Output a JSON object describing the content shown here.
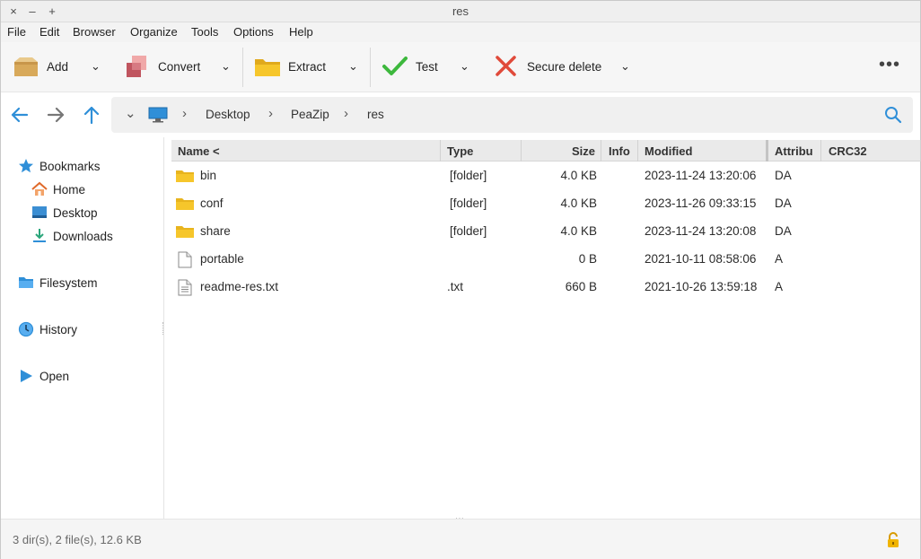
{
  "window": {
    "title": "res",
    "close_glyph": "×",
    "minimize_glyph": "–",
    "maximize_glyph": "+"
  },
  "menu": [
    "File",
    "Edit",
    "Browser",
    "Organize",
    "Tools",
    "Options",
    "Help"
  ],
  "toolbar": {
    "add": "Add",
    "convert": "Convert",
    "extract": "Extract",
    "test": "Test",
    "secure_delete": "Secure delete",
    "more": "•••"
  },
  "breadcrumb": [
    "Desktop",
    "PeaZip",
    "res"
  ],
  "sidebar": {
    "bookmarks": "Bookmarks",
    "home": "Home",
    "desktop": "Desktop",
    "downloads": "Downloads",
    "filesystem": "Filesystem",
    "history": "History",
    "open": "Open"
  },
  "columns": [
    "Name <",
    "Type",
    "Size",
    "Info",
    "Modified",
    "Attribu",
    "CRC32"
  ],
  "files": [
    {
      "name": "bin",
      "type": "[folder]",
      "size": "4.0 KB",
      "modified": "2023-11-24 13:20:06",
      "attrib": "DA",
      "icon": "folder-icon"
    },
    {
      "name": "conf",
      "type": "[folder]",
      "size": "4.0 KB",
      "modified": "2023-11-26 09:33:15",
      "attrib": "DA",
      "icon": "folder-icon"
    },
    {
      "name": "share",
      "type": "[folder]",
      "size": "4.0 KB",
      "modified": "2023-11-24 13:20:08",
      "attrib": "DA",
      "icon": "folder-icon"
    },
    {
      "name": "portable",
      "type": "",
      "size": "0 B",
      "modified": "2021-10-11 08:58:06",
      "attrib": "A",
      "icon": "file-icon"
    },
    {
      "name": "readme-res.txt",
      "type": ".txt",
      "size": "660 B",
      "modified": "2021-10-26 13:59:18",
      "attrib": "A",
      "icon": "text-file-icon"
    }
  ],
  "status": "3 dir(s), 2 file(s), 12.6 KB",
  "colors": {
    "accent_blue": "#2f8fd8",
    "folder_yellow": "#f6c62b",
    "test_green": "#3db83d",
    "delete_red": "#e04a3a",
    "lock_orange": "#f0b400"
  }
}
